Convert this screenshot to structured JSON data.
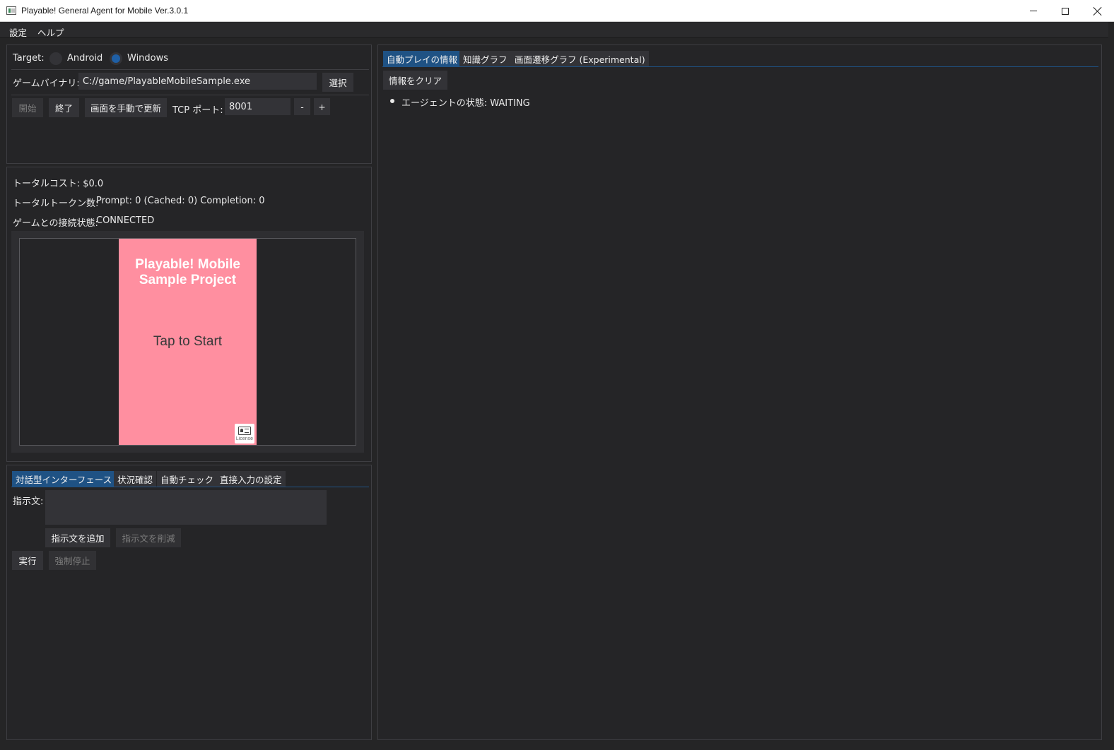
{
  "window": {
    "title": "Playable! General Agent for Mobile Ver.3.0.1",
    "icons": [
      "app-icon",
      "minimize-icon",
      "maximize-icon",
      "close-icon"
    ]
  },
  "menu": {
    "settings": "設定",
    "help": "ヘルプ"
  },
  "control_panel": {
    "target_label": "Target:",
    "target_options": [
      "Android",
      "Windows"
    ],
    "target_selected": "Windows",
    "binary_label": "ゲームバイナリ:",
    "binary_value": "C://game/PlayableMobileSample.exe",
    "select_button": "選択",
    "start_button": "開始",
    "stop_button": "終了",
    "refresh_button": "画面を手動で更新",
    "tcp_label": "TCP ポート:",
    "tcp_value": "8001",
    "decrement": "-",
    "increment": "+"
  },
  "status_panel": {
    "cost_label": "トータルコスト: $0.0",
    "tokens_label": "トータルトークン数:",
    "tokens_value": "Prompt: 0 (Cached: 0) Completion: 0",
    "connection_label": "ゲームとの接続状態:",
    "connection_value": "CONNECTED"
  },
  "game_view": {
    "title": "Playable! Mobile Sample Project",
    "prompt": "Tap to Start",
    "license_label": "License",
    "background_color": "#ff8fa0"
  },
  "interaction_panel": {
    "tabs": [
      "対話型インターフェース",
      "状況確認",
      "自動チェック",
      "直接入力の設定"
    ],
    "active_tab": "対話型インターフェース",
    "instruction_label": "指示文:",
    "instruction_value": "",
    "add_button": "指示文を追加",
    "remove_button": "指示文を削減",
    "run_button": "実行",
    "force_stop_button": "強制停止"
  },
  "info_panel": {
    "tabs": [
      "自動プレイの情報",
      "知識グラフ",
      "画面遷移グラフ (Experimental)"
    ],
    "active_tab": "自動プレイの情報",
    "clear_button": "情報をクリア",
    "items": [
      "エージェントの状態: WAITING"
    ]
  },
  "colors": {
    "accent": "#1f5284",
    "radio_on": "#1f5fa5",
    "background": "#252527"
  }
}
